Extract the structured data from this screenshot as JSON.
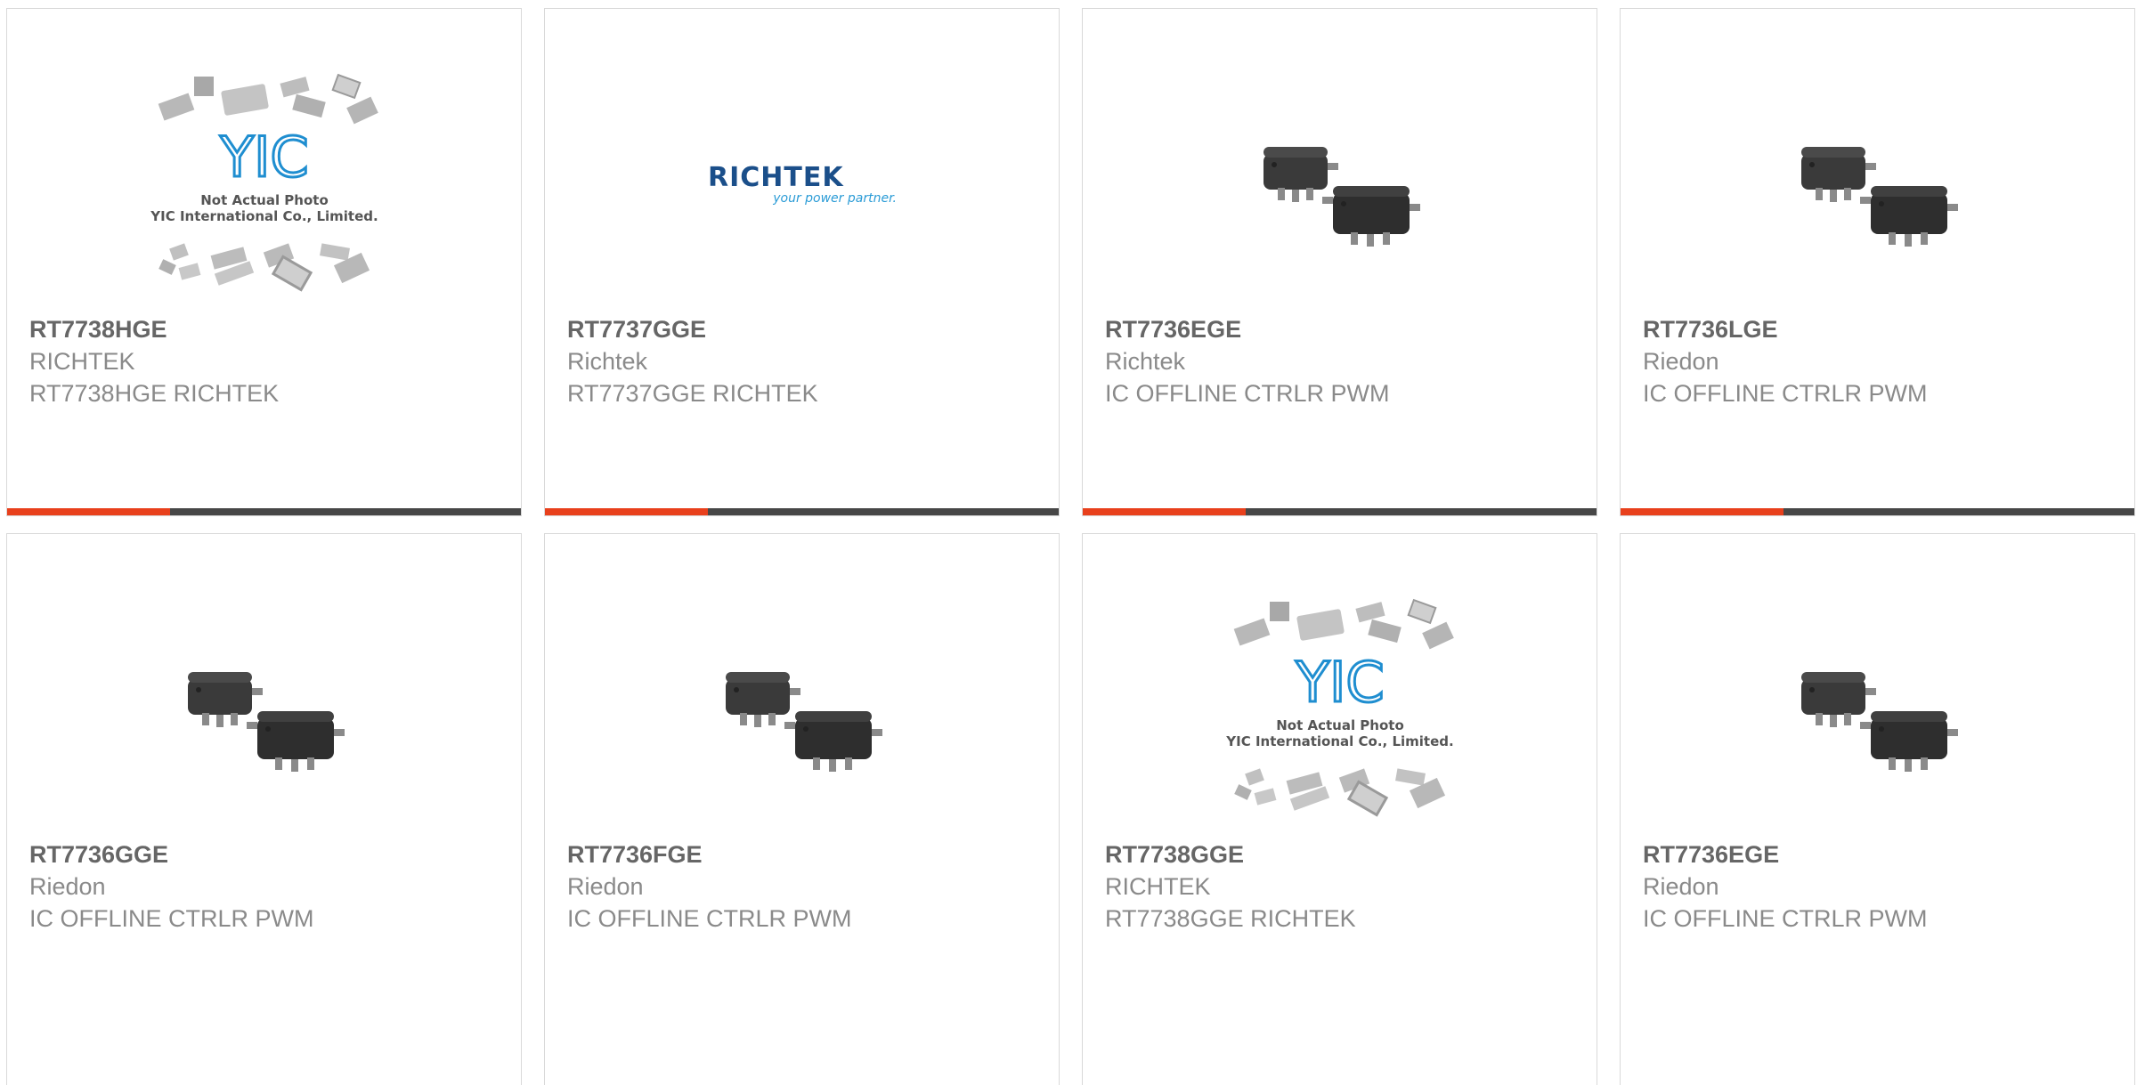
{
  "products": [
    {
      "part_number": "RT7738HGE",
      "manufacturer": "RICHTEK",
      "description": "RT7738HGE RICHTEK",
      "image": "yic-placeholder"
    },
    {
      "part_number": "RT7737GGE",
      "manufacturer": "Richtek",
      "description": "RT7737GGE RICHTEK",
      "image": "richtek-logo"
    },
    {
      "part_number": "RT7736EGE",
      "manufacturer": "Richtek",
      "description": "IC OFFLINE CTRLR PWM",
      "image": "chip-photo"
    },
    {
      "part_number": "RT7736LGE",
      "manufacturer": "Riedon",
      "description": "IC OFFLINE CTRLR PWM",
      "image": "chip-photo"
    },
    {
      "part_number": "RT7736GGE",
      "manufacturer": "Riedon",
      "description": "IC OFFLINE CTRLR PWM",
      "image": "chip-photo"
    },
    {
      "part_number": "RT7736FGE",
      "manufacturer": "Riedon",
      "description": "IC OFFLINE CTRLR PWM",
      "image": "chip-photo"
    },
    {
      "part_number": "RT7738GGE",
      "manufacturer": "RICHTEK",
      "description": "RT7738GGE RICHTEK",
      "image": "yic-placeholder"
    },
    {
      "part_number": "RT7736EGE",
      "manufacturer": "Riedon",
      "description": "IC OFFLINE CTRLR PWM",
      "image": "chip-photo"
    }
  ],
  "placeholder_image": {
    "logo": "YIC",
    "line1": "Not Actual Photo",
    "line2": "YIC International Co., Limited."
  },
  "richtek_logo": {
    "wordmark": "RICHTEK",
    "tagline": "your power partner."
  },
  "colors": {
    "accent_red": "#e8401c",
    "bar_dark": "#474747",
    "part_number": "#666666",
    "secondary_text": "#8a8a8a",
    "richtek_blue": "#1b4f8a",
    "richtek_tagline": "#2a9bd6",
    "yic_blue": "#1f8ed0"
  }
}
